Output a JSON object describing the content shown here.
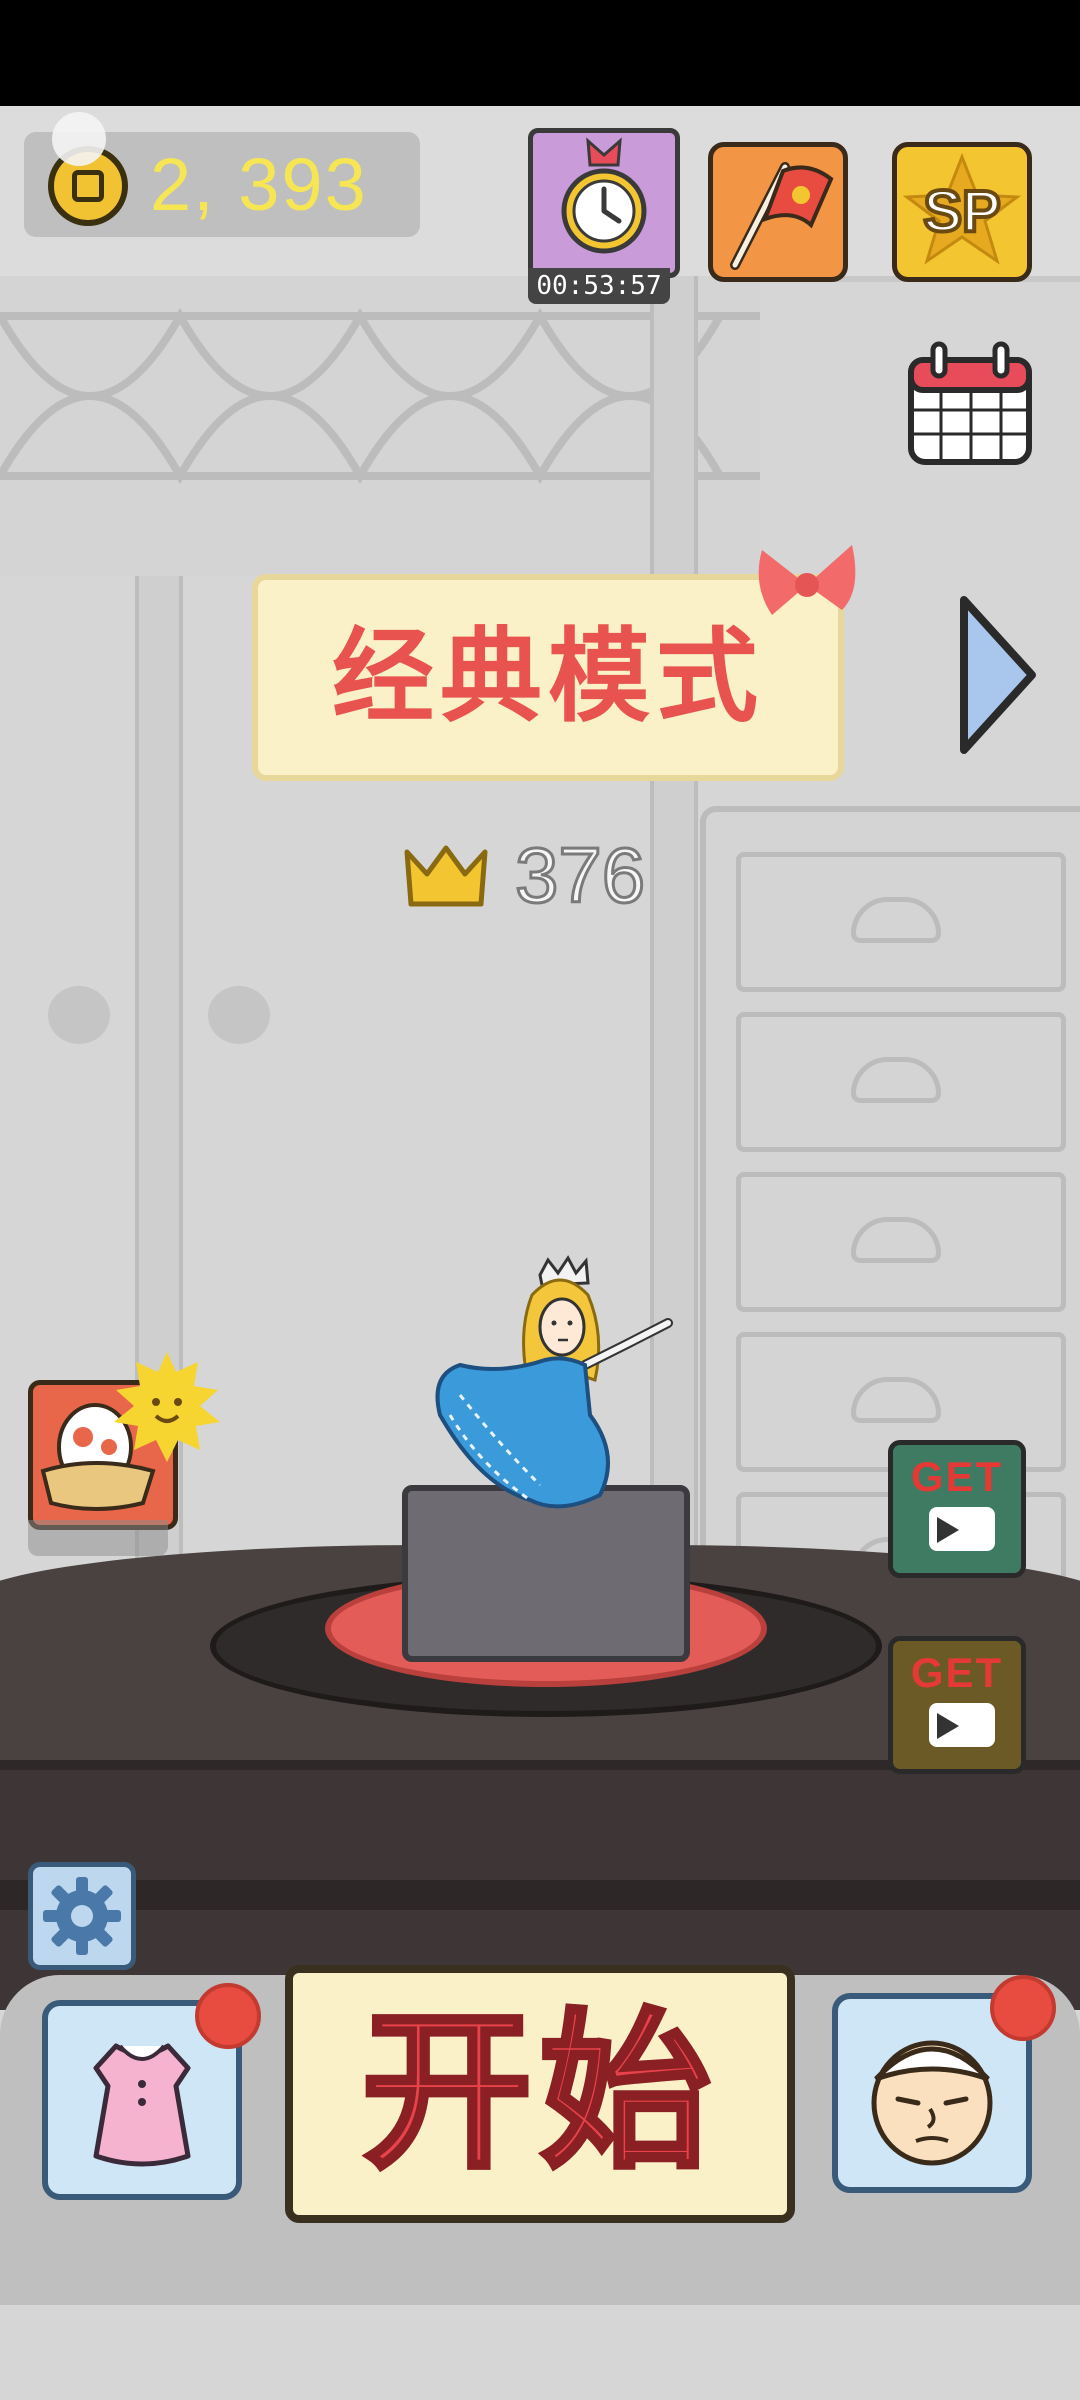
{
  "hud": {
    "coins": "2, 393",
    "timer": "00:53:57"
  },
  "top_buttons": {
    "sp_label": "SP",
    "icons": [
      "alarm-clock-icon",
      "flag-icon",
      "sp-star-icon",
      "calendar-icon"
    ]
  },
  "mode": {
    "title": "经典模式"
  },
  "score": {
    "best": "376"
  },
  "side_buttons": {
    "get_top_label": "GET",
    "get_bottom_label": "GET"
  },
  "bottom": {
    "start_label": "开始"
  },
  "colors": {
    "mode_text": "#e8534f",
    "start_text": "#e8434a",
    "coin_text": "#f6e653",
    "notification_dot": "#e84b3f"
  }
}
